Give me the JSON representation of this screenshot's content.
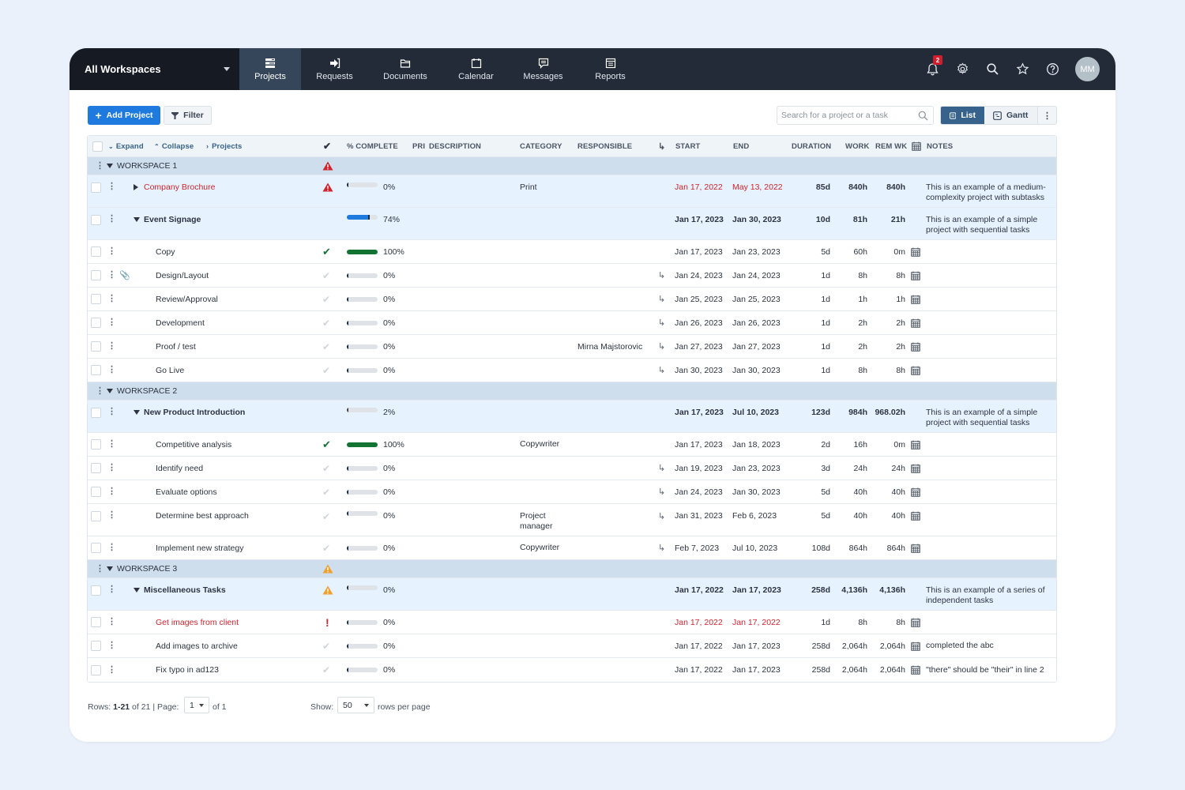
{
  "topbar": {
    "workspace_selector": "All Workspaces",
    "nav": [
      {
        "label": "Projects",
        "icon": "projects-icon",
        "active": true
      },
      {
        "label": "Requests",
        "icon": "requests-icon",
        "active": false
      },
      {
        "label": "Documents",
        "icon": "folder-icon",
        "active": false
      },
      {
        "label": "Calendar",
        "icon": "calendar-icon",
        "active": false
      },
      {
        "label": "Messages",
        "icon": "message-icon",
        "active": false
      },
      {
        "label": "Reports",
        "icon": "reports-icon",
        "active": false
      }
    ],
    "notifications_count": "2",
    "user_initials": "MM"
  },
  "toolbar": {
    "add_project_label": "Add Project",
    "filter_label": "Filter",
    "search_placeholder": "Search for a project or a task",
    "view_list_label": "List",
    "view_gantt_label": "Gantt",
    "more_label": "⋮"
  },
  "table": {
    "header": {
      "expand": "Expand",
      "collapse": "Collapse",
      "projects": "Projects",
      "complete": "% COMPLETE",
      "pri": "PRI",
      "description": "DESCRIPTION",
      "category": "CATEGORY",
      "responsible": "RESPONSIBLE",
      "start": "START",
      "end": "END",
      "duration": "DURATION",
      "work": "WORK",
      "rem_wk": "REM WK",
      "notes": "NOTES"
    },
    "rows": [
      {
        "type": "ws",
        "name": "WORKSPACE 1",
        "status": "alert-red"
      },
      {
        "type": "proj",
        "name": "Company Brochure",
        "expanded": false,
        "late": true,
        "status": "alert-red",
        "progress": 0,
        "progress_label": "0%",
        "category": "Print",
        "responsible": "",
        "start": "Jan 17, 2022",
        "end": "May 13, 2022",
        "duration": "85d",
        "work": "840h",
        "rem": "840h",
        "notes": "This is an example of a medium-complexity project with subtasks"
      },
      {
        "type": "proj",
        "name": "Event Signage",
        "expanded": true,
        "late": false,
        "status": "",
        "progress": 74,
        "progress_label": "74%",
        "category": "",
        "responsible": "",
        "start": "Jan 17, 2023",
        "end": "Jan 30, 2023",
        "duration": "10d",
        "work": "81h",
        "rem": "21h",
        "notes": "This is an example of a simple project with sequential tasks"
      },
      {
        "type": "task",
        "name": "Copy",
        "status": "done",
        "progress": 100,
        "progress_label": "100%",
        "category": "",
        "responsible": "",
        "dep": false,
        "start": "Jan 17, 2023",
        "end": "Jan 23, 2023",
        "duration": "5d",
        "work": "60h",
        "rem": "0m",
        "notes": "",
        "attachment": false
      },
      {
        "type": "task",
        "name": "Design/Layout",
        "status": "todo",
        "progress": 0,
        "progress_label": "0%",
        "category": "",
        "responsible": "",
        "dep": true,
        "start": "Jan 24, 2023",
        "end": "Jan 24, 2023",
        "duration": "1d",
        "work": "8h",
        "rem": "8h",
        "notes": "",
        "attachment": true
      },
      {
        "type": "task",
        "name": "Review/Approval",
        "status": "todo",
        "progress": 0,
        "progress_label": "0%",
        "category": "",
        "responsible": "",
        "dep": true,
        "start": "Jan 25, 2023",
        "end": "Jan 25, 2023",
        "duration": "1d",
        "work": "1h",
        "rem": "1h",
        "notes": "",
        "attachment": false
      },
      {
        "type": "task",
        "name": "Development",
        "status": "todo",
        "progress": 0,
        "progress_label": "0%",
        "category": "",
        "responsible": "",
        "dep": true,
        "start": "Jan 26, 2023",
        "end": "Jan 26, 2023",
        "duration": "1d",
        "work": "2h",
        "rem": "2h",
        "notes": "",
        "attachment": false
      },
      {
        "type": "task",
        "name": "Proof / test",
        "status": "todo",
        "progress": 0,
        "progress_label": "0%",
        "category": "",
        "responsible": "Mirna Majstorovic",
        "dep": true,
        "start": "Jan 27, 2023",
        "end": "Jan 27, 2023",
        "duration": "1d",
        "work": "2h",
        "rem": "2h",
        "notes": "",
        "attachment": false
      },
      {
        "type": "task",
        "name": "Go Live",
        "status": "todo",
        "progress": 0,
        "progress_label": "0%",
        "category": "",
        "responsible": "",
        "dep": true,
        "start": "Jan 30, 2023",
        "end": "Jan 30, 2023",
        "duration": "1d",
        "work": "8h",
        "rem": "8h",
        "notes": "",
        "attachment": false
      },
      {
        "type": "ws",
        "name": "WORKSPACE 2",
        "status": ""
      },
      {
        "type": "proj",
        "name": "New Product Introduction",
        "expanded": true,
        "late": false,
        "status": "",
        "progress": 2,
        "progress_label": "2%",
        "category": "",
        "responsible": "",
        "start": "Jan 17, 2023",
        "end": "Jul 10, 2023",
        "duration": "123d",
        "work": "984h",
        "rem": "968.02h",
        "notes": "This is an example of a simple project with sequential tasks"
      },
      {
        "type": "task",
        "name": "Competitive analysis",
        "status": "done",
        "progress": 100,
        "progress_label": "100%",
        "category": "Copywriter",
        "responsible": "",
        "dep": false,
        "start": "Jan 17, 2023",
        "end": "Jan 18, 2023",
        "duration": "2d",
        "work": "16h",
        "rem": "0m",
        "notes": "",
        "attachment": false
      },
      {
        "type": "task",
        "name": "Identify need",
        "status": "todo",
        "progress": 0,
        "progress_label": "0%",
        "category": "",
        "responsible": "",
        "dep": true,
        "start": "Jan 19, 2023",
        "end": "Jan 23, 2023",
        "duration": "3d",
        "work": "24h",
        "rem": "24h",
        "notes": "",
        "attachment": false
      },
      {
        "type": "task",
        "name": "Evaluate options",
        "status": "todo",
        "progress": 0,
        "progress_label": "0%",
        "category": "",
        "responsible": "",
        "dep": true,
        "start": "Jan 24, 2023",
        "end": "Jan 30, 2023",
        "duration": "5d",
        "work": "40h",
        "rem": "40h",
        "notes": "",
        "attachment": false
      },
      {
        "type": "task",
        "name": "Determine best approach",
        "status": "todo",
        "progress": 0,
        "progress_label": "0%",
        "category": "Project manager",
        "responsible": "",
        "dep": true,
        "start": "Jan 31, 2023",
        "end": "Feb 6, 2023",
        "duration": "5d",
        "work": "40h",
        "rem": "40h",
        "notes": "",
        "attachment": false,
        "tall": true
      },
      {
        "type": "task",
        "name": "Implement new strategy",
        "status": "todo",
        "progress": 0,
        "progress_label": "0%",
        "category": "Copywriter",
        "responsible": "",
        "dep": true,
        "start": "Feb 7, 2023",
        "end": "Jul 10, 2023",
        "duration": "108d",
        "work": "864h",
        "rem": "864h",
        "notes": "",
        "attachment": false
      },
      {
        "type": "ws",
        "name": "WORKSPACE 3",
        "status": "alert-orange"
      },
      {
        "type": "proj",
        "name": "Miscellaneous Tasks",
        "expanded": true,
        "late": false,
        "status": "alert-orange",
        "progress": 0,
        "progress_label": "0%",
        "category": "",
        "responsible": "",
        "start": "Jan 17, 2022",
        "end": "Jan 17, 2023",
        "duration": "258d",
        "work": "4,136h",
        "rem": "4,136h",
        "notes": "This is an example of a series of independent tasks"
      },
      {
        "type": "task",
        "name": "Get images from client",
        "late": true,
        "status": "overdue",
        "progress": 0,
        "progress_label": "0%",
        "category": "",
        "responsible": "",
        "dep": false,
        "start": "Jan 17, 2022",
        "end": "Jan 17, 2022",
        "duration": "1d",
        "work": "8h",
        "rem": "8h",
        "notes": "",
        "attachment": false
      },
      {
        "type": "task",
        "name": "Add images to archive",
        "status": "todo",
        "progress": 0,
        "progress_label": "0%",
        "category": "",
        "responsible": "",
        "dep": false,
        "start": "Jan 17, 2022",
        "end": "Jan 17, 2023",
        "duration": "258d",
        "work": "2,064h",
        "rem": "2,064h",
        "notes": "completed the abc",
        "attachment": false
      },
      {
        "type": "task",
        "name": "Fix typo in ad123",
        "status": "todo",
        "progress": 0,
        "progress_label": "0%",
        "category": "",
        "responsible": "",
        "dep": false,
        "start": "Jan 17, 2022",
        "end": "Jan 17, 2023",
        "duration": "258d",
        "work": "2,064h",
        "rem": "2,064h",
        "notes": "\"there\" should be \"their\" in line 2",
        "attachment": false
      }
    ]
  },
  "footer": {
    "rows_prefix": "Rows:",
    "rows_range": "1-21",
    "rows_of": "of 21",
    "separator": "|",
    "page_label": "Page:",
    "page_value": "1",
    "page_of": "of 1",
    "show_label": "Show:",
    "per_page_value": "50",
    "per_page_suffix": "rows per page"
  },
  "colors": {
    "primary": "#1f7ae0",
    "nav_bg": "#232b38",
    "late_red": "#d0242e",
    "done_green": "#137333",
    "warn_orange": "#f0a030"
  }
}
